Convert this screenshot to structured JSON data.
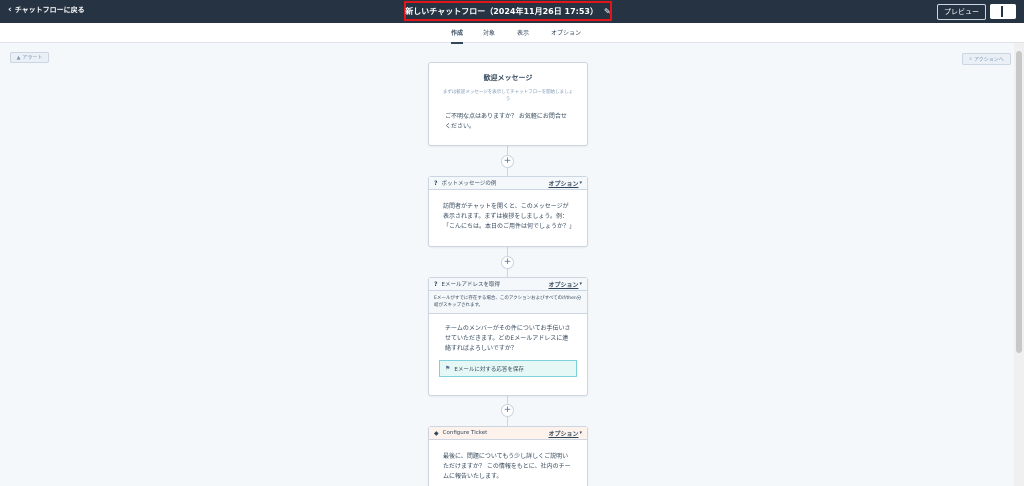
{
  "topbar": {
    "back_label": "チャットフローに戻る",
    "title": "新しいチャットフロー（2024年11月26日 17:53）",
    "preview_label": "プレビュー"
  },
  "tabs": [
    {
      "label": "作成"
    },
    {
      "label": "対象"
    },
    {
      "label": "表示"
    },
    {
      "label": "オプション"
    }
  ],
  "alert_label": "アラート",
  "action_label": "アクションへ",
  "welcome": {
    "title": "歓迎メッセージ",
    "subtitle": "まずは歓迎メッセージを表示してチャットフローを開始しましょう",
    "body": "ご不明な点はありますか？ お気軽にお問合せください。"
  },
  "bot_card": {
    "title": "ボットメッセージの例",
    "option_label": "オプション",
    "body": "訪問者がチャットを開くと、このメッセージが表示されます。まずは挨拶をしましょう。例：「こんにちは。本日のご用件は何でしょうか？」"
  },
  "email_card": {
    "title": "Eメールアドレスを取得",
    "option_label": "オプション",
    "note": "Eメールがすでに存在する場合、このアクションおよびすべてのif/then分岐がスキップされます。",
    "body": "チームのメンバーがその件についてお手伝いさせていただきます。どのEメールアドレスに連絡すればよろしいですか？",
    "save_label": "Eメールに対する応答を保存"
  },
  "ticket_card": {
    "title": "Configure Ticket",
    "option_label": "オプション",
    "body": "最後に、問題についてもう少し詳しくご説明いただけますか？ この情報をもとに、社内のチームに報告いたします。"
  },
  "colors": {
    "topbar_bg": "#253342",
    "highlight_border": "#e0161b",
    "canvas_bg": "#f5f8fa",
    "save_row_bg": "#e5f8f6"
  }
}
